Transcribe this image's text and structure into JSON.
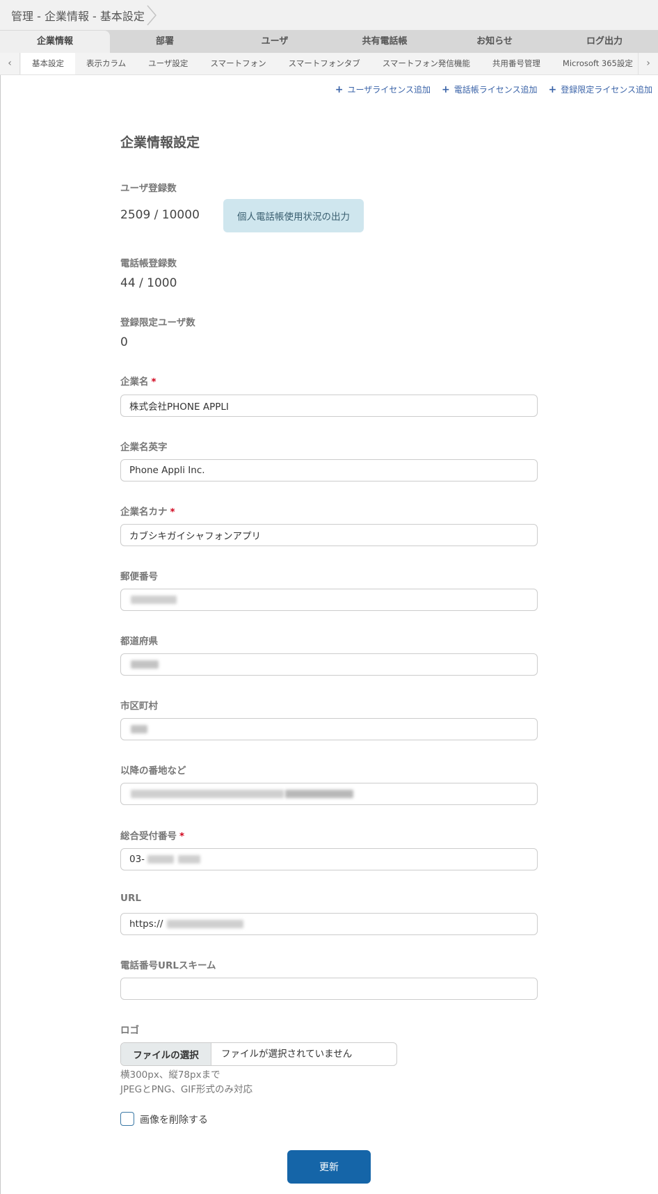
{
  "breadcrumb": {
    "text": "管理 - 企業情報 - 基本設定"
  },
  "main_tabs": [
    "企業情報",
    "部署",
    "ユーザ",
    "共有電話帳",
    "お知らせ",
    "ログ出力"
  ],
  "sub_tabs": [
    "基本設定",
    "表示カラム",
    "ユーザ設定",
    "スマートフォン",
    "スマートフォンタブ",
    "スマートフォン発信機能",
    "共用番号管理",
    "Microsoft 365設定"
  ],
  "license_links": [
    "ユーザライセンス追加",
    "電話帳ライセンス追加",
    "登録限定ライセンス追加"
  ],
  "section_title": "企業情報設定",
  "user_count": {
    "label": "ユーザ登録数",
    "value": "2509 / 10000",
    "export_label": "個人電話帳使用状況の出力"
  },
  "phonebook_count": {
    "label": "電話帳登録数",
    "value": "44 / 1000"
  },
  "limited_user_count": {
    "label": "登録限定ユーザ数",
    "value": "0"
  },
  "fields": {
    "company_name": {
      "label": "企業名",
      "required": "*",
      "value": "株式会社PHONE APPLI"
    },
    "company_name_en": {
      "label": "企業名英字",
      "value": "Phone Appli Inc."
    },
    "company_name_kana": {
      "label": "企業名カナ",
      "required": "*",
      "value": "カブシキガイシャフォンアプリ"
    },
    "postal_code": {
      "label": "郵便番号",
      "value": ""
    },
    "prefecture": {
      "label": "都道府県",
      "value": ""
    },
    "city": {
      "label": "市区町村",
      "value": ""
    },
    "address": {
      "label": "以降の番地など",
      "value": ""
    },
    "main_phone": {
      "label": "総合受付番号",
      "required": "*",
      "value": "03-"
    },
    "url": {
      "label": "URL",
      "value": "https://"
    },
    "tel_url_scheme": {
      "label": "電話番号URLスキーム",
      "value": ""
    }
  },
  "logo": {
    "label": "ロゴ",
    "file_button": "ファイルの選択",
    "file_status": "ファイルが選択されていません",
    "hint_size": "横300px、縦78pxまで",
    "hint_format": "JPEGとPNG、GIF形式のみ対応",
    "delete_label": "画像を削除する"
  },
  "submit_label": "更新"
}
